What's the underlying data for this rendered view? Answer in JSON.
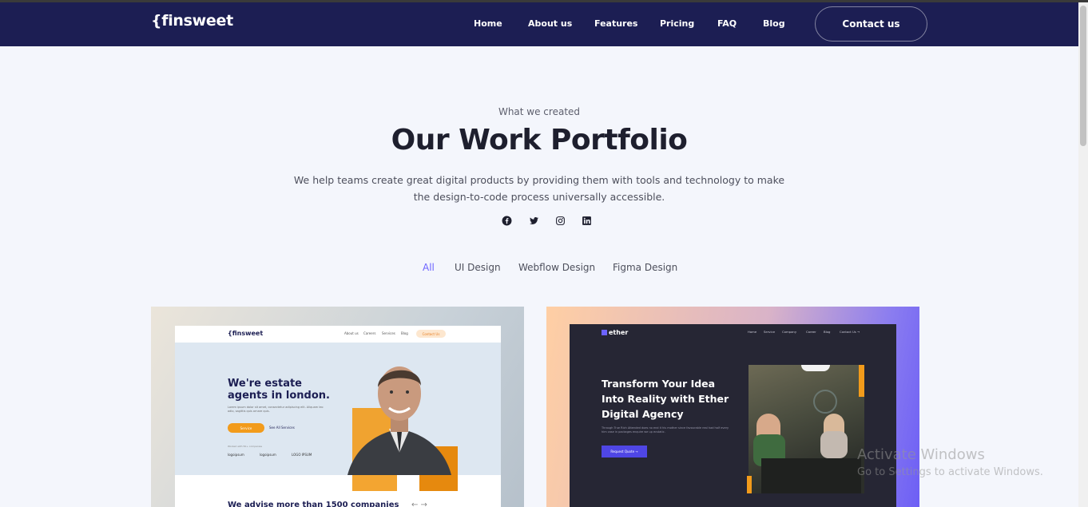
{
  "header": {
    "logo": "{finsweet",
    "nav": [
      "Home",
      "About us",
      "Features",
      "Pricing",
      "FAQ",
      "Blog"
    ],
    "contact_label": "Contact us"
  },
  "hero": {
    "eyebrow": "What we created",
    "title": "Our Work Portfolio",
    "description": "We help teams create great digital products by providing them with tools and technology to make the design-to-code process universally accessible.",
    "social_icons": [
      "facebook-icon",
      "twitter-icon",
      "instagram-icon",
      "linkedin-icon"
    ]
  },
  "filters": {
    "items": [
      "All",
      "UI Design",
      "Webflow Design",
      "Figma Design"
    ],
    "active": "All"
  },
  "cards": {
    "left": {
      "logo": "{finsweet",
      "nav": [
        "About us",
        "Careers",
        "Services",
        "Blog"
      ],
      "contact": "Contact Us",
      "headline": "We're estate agents in london.",
      "body": "Lorem ipsum dolor sit amet, consectetur adipiscing elit. Aliquam leo odio, sagittis quis ornare quis.",
      "primary_btn": "Service",
      "secondary_btn": "See All Services",
      "trusted": "Worked with 50+ companies",
      "logos": [
        "logoipsum",
        "logoipsum",
        "LOGO IPSUM"
      ],
      "bottom_text": "We advise more than 1500 companies",
      "arrows": "←   →"
    },
    "right": {
      "logo": "ether",
      "nav": [
        "Home",
        "Service",
        "Company",
        "Career",
        "Blog",
        "Contact Us →"
      ],
      "headline": "Transform Your Idea Into Reality with Ether Digital Agency",
      "body": "Through True Rich Attended does no end it his mother since favourable real had half every him case in packages enquire we up ecstatic.",
      "button": "Request Quote →"
    }
  },
  "os_watermark": {
    "line1": "Activate Windows",
    "line2": "Go to Settings to activate Windows."
  },
  "colors": {
    "navbar": "#1c1e53",
    "accent": "#6c63ff",
    "orange": "#f29b1b"
  }
}
